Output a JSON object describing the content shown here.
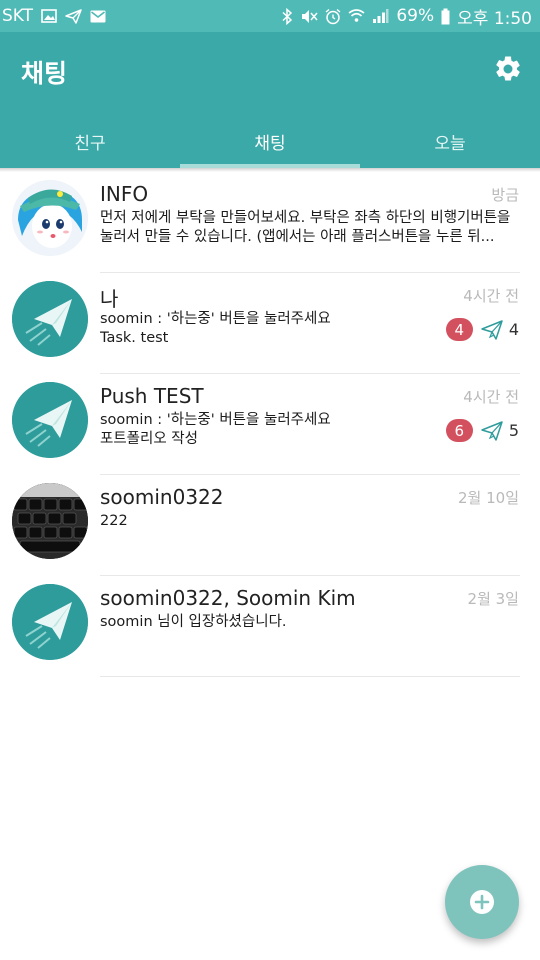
{
  "status_bar": {
    "carrier": "SKT",
    "battery_percent": "69%",
    "time": "오후 1:50",
    "left_icons": [
      "image-icon",
      "send-icon",
      "mail-icon"
    ],
    "right_icons": [
      "bluetooth-icon",
      "mute-icon",
      "alarm-icon",
      "wifi-icon",
      "signal-icon",
      "battery-icon"
    ]
  },
  "header": {
    "title": "채팅",
    "settings_icon": "gear-icon",
    "color": "#3aa9a8"
  },
  "tabs": [
    {
      "label": "친구",
      "active": false
    },
    {
      "label": "채팅",
      "active": true
    },
    {
      "label": "오늘",
      "active": false
    }
  ],
  "chats": [
    {
      "name": "INFO",
      "time": "방금",
      "avatar": "character-avatar",
      "preview": [
        "먼저 저에게 부탁을 만들어보세요. 부탁은 좌측 하단의 비행기버튼을",
        "눌러서 만들 수 있습니다. (앱에서는 아래 플러스버튼을 누른 뒤..."
      ]
    },
    {
      "name": "나",
      "time": "4시간 전",
      "avatar": "paper-plane-avatar",
      "preview": [
        "soomin : '하는중' 버튼을 눌러주세요",
        "Task. test"
      ],
      "unread": "4",
      "sent": "4"
    },
    {
      "name": "Push TEST",
      "time": "4시간 전",
      "avatar": "paper-plane-avatar",
      "preview": [
        "soomin : '하는중' 버튼을 눌러주세요",
        "포트폴리오 작성"
      ],
      "unread": "6",
      "sent": "5"
    },
    {
      "name": "soomin0322",
      "time": "2월 10일",
      "avatar": "keyboard-photo-avatar",
      "preview": [
        "222"
      ]
    },
    {
      "name": "soomin0322, Soomin Kim",
      "time": "2월 3일",
      "avatar": "paper-plane-avatar",
      "preview": [
        "soomin 님이 입장하셨습니다."
      ]
    }
  ],
  "fab": {
    "icon": "plus-icon",
    "color": "#7fc3bd"
  },
  "colors": {
    "unread_badge": "#d3505f",
    "status_bar": "#4fbab6"
  }
}
